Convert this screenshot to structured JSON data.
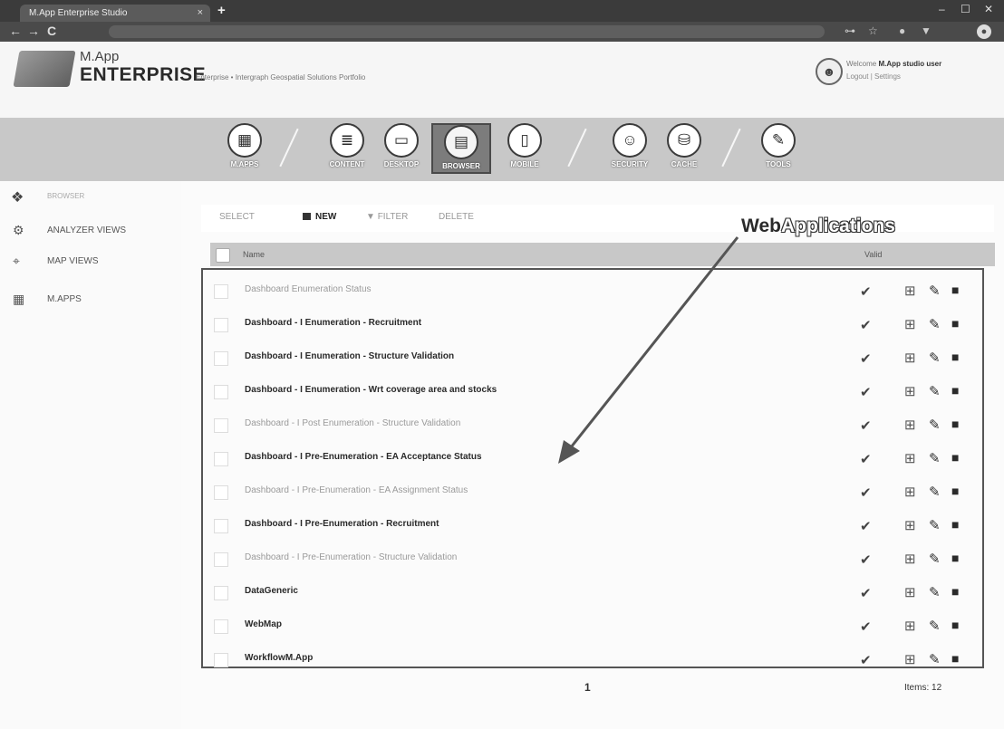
{
  "browser": {
    "tab_title": "M.App Enterprise Studio",
    "tab_close": "×",
    "new_tab": "+",
    "window_controls": [
      "–",
      "☐",
      "✕"
    ],
    "nav": [
      "←",
      "→",
      "C"
    ],
    "nav_right": [
      "⊶",
      "☆",
      "●",
      "▼"
    ]
  },
  "header": {
    "brand_small": "M.App",
    "brand_big": "ENTERPRISE",
    "brand_sub": "Enterprise • Intergraph Geospatial Solutions Portfolio",
    "user_line1_prefix": "Welcome",
    "user_name": "M.App studio user",
    "user_line2": "Logout | Settings"
  },
  "modules": [
    {
      "label": "M.APPS",
      "icon": "▦"
    },
    {
      "label": "CONTENT",
      "icon": "≣"
    },
    {
      "label": "DESKTOP",
      "icon": "▭"
    },
    {
      "label": "BROWSER",
      "icon": "▤"
    },
    {
      "label": "MOBILE",
      "icon": "▯"
    },
    {
      "label": "SECURITY",
      "icon": "☺"
    },
    {
      "label": "CACHE",
      "icon": "⛁"
    },
    {
      "label": "TOOLS",
      "icon": "✎"
    }
  ],
  "sidebar": {
    "logo_label": "BROWSER",
    "items": [
      {
        "label": "ANALYZER VIEWS",
        "icon": "⚙"
      },
      {
        "label": "MAP VIEWS",
        "icon": "⌖"
      },
      {
        "label": "M.APPS",
        "icon": "▦"
      }
    ]
  },
  "toolbar": {
    "select_label": "SELECT",
    "new_label": "NEW",
    "filter_label": "FILTER",
    "delete_label": "DELETE"
  },
  "annotation": {
    "word1": "Web",
    "word2": "Applications"
  },
  "table": {
    "col_name": "Name",
    "col_valid": "Valid",
    "rows": [
      {
        "name": "Dashboard Enumeration Status",
        "dim": true
      },
      {
        "name": "Dashboard - I Enumeration - Recruitment",
        "dim": false
      },
      {
        "name": "Dashboard - I Enumeration - Structure Validation",
        "dim": false
      },
      {
        "name": "Dashboard - I Enumeration - Wrt coverage area and stocks",
        "dim": false
      },
      {
        "name": "Dashboard - I Post Enumeration - Structure Validation",
        "dim": true
      },
      {
        "name": "Dashboard - I Pre-Enumeration - EA Acceptance Status",
        "dim": false
      },
      {
        "name": "Dashboard - I Pre-Enumeration - EA Assignment Status",
        "dim": true
      },
      {
        "name": "Dashboard - I Pre-Enumeration - Recruitment",
        "dim": false
      },
      {
        "name": "Dashboard - I Pre-Enumeration - Structure Validation",
        "dim": true
      },
      {
        "name": "DataGeneric",
        "dim": false
      },
      {
        "name": "WebMap",
        "dim": false
      },
      {
        "name": "WorkflowM.App",
        "dim": false
      }
    ],
    "valid_icon": "✔",
    "grid_icon": "⊞",
    "edit_icon": "✎",
    "delete_icon": "■"
  },
  "footer": {
    "page": "1",
    "items": "Items: 12"
  }
}
